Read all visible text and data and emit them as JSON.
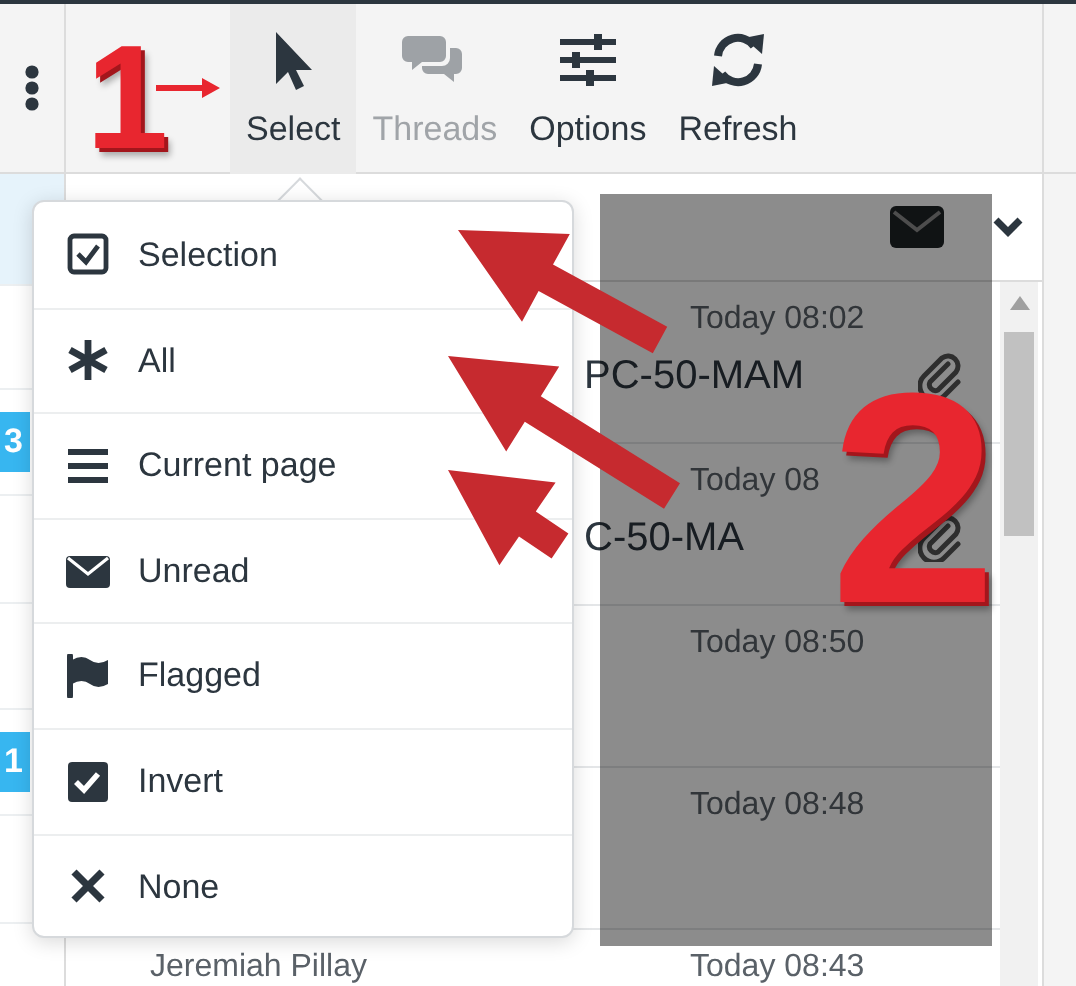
{
  "toolbar": {
    "buttons": [
      {
        "kind": "select",
        "label": "Select",
        "selected": true,
        "disabled": false
      },
      {
        "kind": "threads",
        "label": "Threads",
        "selected": false,
        "disabled": true
      },
      {
        "kind": "options",
        "label": "Options",
        "selected": false,
        "disabled": false
      },
      {
        "kind": "refresh",
        "label": "Refresh",
        "selected": false,
        "disabled": false
      }
    ]
  },
  "folder_badges": [
    {
      "count": "3"
    },
    {
      "count": "1"
    }
  ],
  "message_list": {
    "rows": [
      {
        "date": "Today 08:02",
        "subject": "PC-50-MAM",
        "attachment": true
      },
      {
        "date": "Today 08",
        "subject": "C-50-MA",
        "attachment": true
      },
      {
        "date": "Today 08:50",
        "attachment": false
      },
      {
        "date": "Today 08:48",
        "attachment": false
      },
      {
        "sender": "Jeremiah Pillay",
        "date": "Today 08:43",
        "attachment": false
      }
    ]
  },
  "select_menu": {
    "items": [
      {
        "kind": "selection",
        "label": "Selection"
      },
      {
        "kind": "all",
        "label": "All"
      },
      {
        "kind": "page",
        "label": "Current page"
      },
      {
        "kind": "unread",
        "label": "Unread"
      },
      {
        "kind": "flagged",
        "label": "Flagged"
      },
      {
        "kind": "invert",
        "label": "Invert"
      },
      {
        "kind": "none",
        "label": "None"
      }
    ]
  },
  "annotations": {
    "step_one": "1",
    "step_two": "2"
  }
}
